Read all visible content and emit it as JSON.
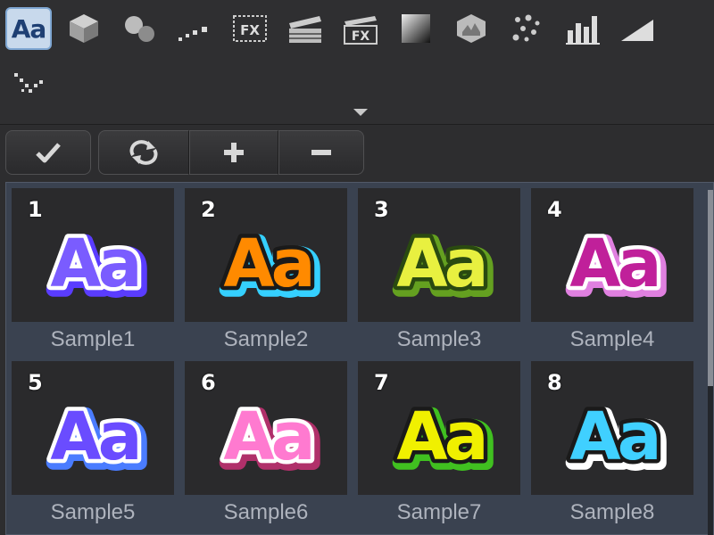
{
  "palette": {
    "row1": [
      {
        "name": "text-style-icon",
        "label": "Aa",
        "selected": true
      },
      {
        "name": "cube-icon"
      },
      {
        "name": "spheres-icon"
      },
      {
        "name": "dotted-line-icon"
      },
      {
        "name": "fx-frame-icon",
        "label": "FX"
      },
      {
        "name": "clapperboard-icon"
      },
      {
        "name": "fx-clapper-icon",
        "label": "FX"
      },
      {
        "name": "gradient-square-icon"
      },
      {
        "name": "gem-box-icon"
      },
      {
        "name": "dots-cluster-icon"
      },
      {
        "name": "bar-chart-icon"
      },
      {
        "name": "wedge-icon"
      }
    ],
    "row2": [
      {
        "name": "dotted-v-icon"
      }
    ]
  },
  "buttons": [
    {
      "name": "apply-button",
      "icon": "checkmark-icon"
    },
    {
      "name": "refresh-button",
      "icon": "refresh-icon"
    },
    {
      "name": "add-button",
      "icon": "plus-icon"
    },
    {
      "name": "remove-button",
      "icon": "minus-icon"
    }
  ],
  "samples": [
    {
      "number": "1",
      "label": "Sample1",
      "text": "Aa",
      "fill": "#7a5cff",
      "outline": "#ffffff",
      "glow": "#5a3cff"
    },
    {
      "number": "2",
      "label": "Sample2",
      "text": "Aa",
      "fill": "#ff8a00",
      "outline": "#1a1a1a",
      "glow": "#35d0ff"
    },
    {
      "number": "3",
      "label": "Sample3",
      "text": "Aa",
      "fill": "#e8f040",
      "outline": "#2a4a10",
      "glow": "#64a020"
    },
    {
      "number": "4",
      "label": "Sample4",
      "text": "Aa",
      "fill": "#c0209a",
      "outline": "#ffffff",
      "glow": "#e080e0"
    },
    {
      "number": "5",
      "label": "Sample5",
      "text": "Aa",
      "fill": "#6a4cff",
      "outline": "#ffffff",
      "glow": "#4a7cff"
    },
    {
      "number": "6",
      "label": "Sample6",
      "text": "Aa",
      "fill": "#ff7ad0",
      "outline": "#ffffff",
      "glow": "#b0306a"
    },
    {
      "number": "7",
      "label": "Sample7",
      "text": "Aa",
      "fill": "#f0f000",
      "outline": "#1a1a1a",
      "glow": "#40c020"
    },
    {
      "number": "8",
      "label": "Sample8",
      "text": "Aa",
      "fill": "#40d0ff",
      "outline": "#1a1a1a",
      "glow": "#ffffff"
    }
  ]
}
